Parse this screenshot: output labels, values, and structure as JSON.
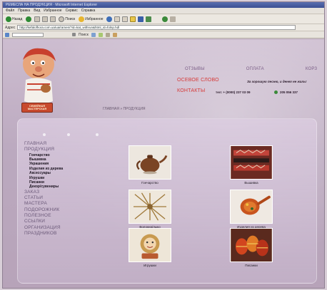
{
  "browser": {
    "title": "РЕМЕСЛА НА ПРОДУКЦИЯ · Microsoft Internet Explorer",
    "menu": [
      "Файл",
      "Правка",
      "Вид",
      "Избранное",
      "Сервис",
      "Справка"
    ],
    "toolbar": {
      "back_label": "Назад",
      "search_label": "Поиск",
      "favorites_label": "Избранное"
    },
    "address_label": "Адрес",
    "address_value": "http://kefalofhora.com.ua/ua/ramen/?id=kat_withrun&html_id=folnp.hdl",
    "links_label": "Поиск"
  },
  "header": {
    "logo_caption": "СЕМЕЙНАЯ МАСТЕРСКАЯ",
    "nav": [
      "ОТЗЫВЫ",
      "ОПЛАТА",
      "КОРЗ"
    ],
    "guestbook": "ОСЕВОЕ СЛОВО",
    "contacts": "КОНТАКТЫ",
    "slogan": "За хорошую песню, и денег не жаль!",
    "phone1": "тел: + (0000) 237 03 09",
    "phone2": "205 056 337"
  },
  "breadcrumb": "ГЛАВНАЯ » ПРОДУКЦИЯ",
  "sidebar": {
    "items": [
      {
        "label": "ГЛАВНАЯ",
        "sub": []
      },
      {
        "label": "ПРОДУКЦИЯ",
        "sub": [
          "Гончарство",
          "Вышивка",
          "Украшения",
          "Изделия из дерева",
          "Аксессуары",
          "Игрушки",
          "Писанки",
          "Декор/сувениры"
        ]
      },
      {
        "label": "ЗАКАЗ",
        "sub": []
      },
      {
        "label": "СТАТЬИ",
        "sub": []
      },
      {
        "label": "МАСТЕРА",
        "sub": []
      },
      {
        "label": "ПОДОРОЖНИК",
        "sub": []
      },
      {
        "label": "ПОЛЕЗНОЕ",
        "sub": []
      },
      {
        "label": "ССЫЛКИ",
        "sub": []
      },
      {
        "label": "ОРГАНИЗАЦИЯ",
        "sub": []
      },
      {
        "label": "ПРАЗДНИКОВ",
        "sub": []
      }
    ]
  },
  "products": [
    {
      "caption": "Гончарство"
    },
    {
      "caption": "Вышивка"
    },
    {
      "caption": "Волокна/лыко"
    },
    {
      "caption": "Изделия из дерева"
    },
    {
      "caption": "Игрушки"
    },
    {
      "caption": "Писанки"
    }
  ],
  "colors": {
    "accent_red": "#d63a38",
    "nav_purple": "#7a5d86",
    "page_bg": "#c2b0c6"
  }
}
